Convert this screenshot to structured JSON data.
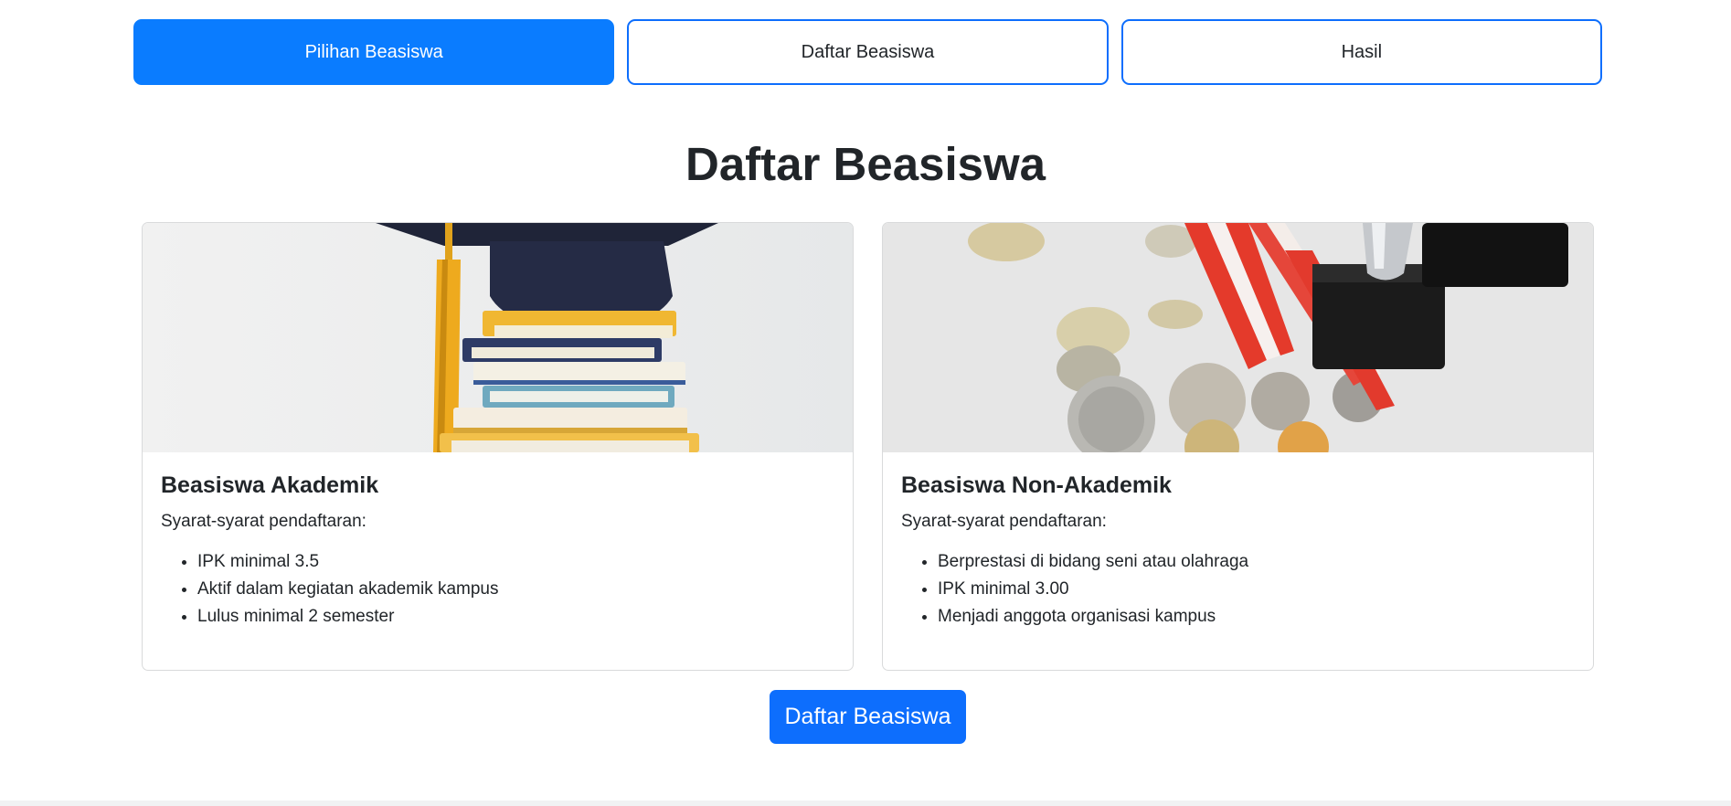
{
  "tabs": [
    {
      "label": "Pilihan Beasiswa",
      "active": true
    },
    {
      "label": "Daftar Beasiswa",
      "active": false
    },
    {
      "label": "Hasil",
      "active": false
    }
  ],
  "page_title": "Daftar Beasiswa",
  "cards": [
    {
      "title": "Beasiswa Akademik",
      "intro": "Syarat-syarat pendaftaran:",
      "requirements": [
        "IPK minimal 3.5",
        "Aktif dalam kegiatan akademik kampus",
        "Lulus minimal 2 semester"
      ]
    },
    {
      "title": "Beasiswa Non-Akademik",
      "intro": "Syarat-syarat pendaftaran:",
      "requirements": [
        "Berprestasi di bidang seni atau olahraga",
        "IPK minimal 3.00",
        "Menjadi anggota organisasi kampus"
      ]
    }
  ],
  "submit_label": "Daftar Beasiswa",
  "colors": {
    "primary": "#0d6efd",
    "active_tab": "#0a7cff",
    "text": "#212529"
  }
}
